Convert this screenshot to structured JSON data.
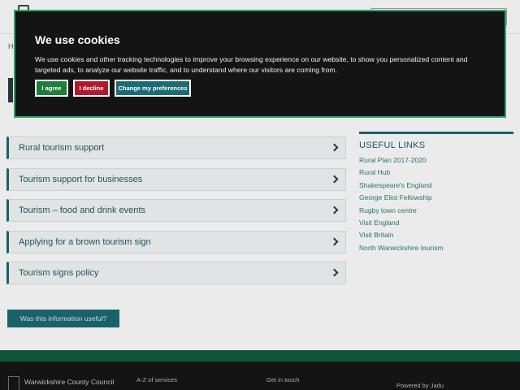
{
  "cookie_banner": {
    "title": "We use cookies",
    "body": "We use cookies and other tracking technologies to improve your browsing experience on our website, to show you personalized content and targeted ads, to analyze our website traffic, and to understand where our visitors are coming from.",
    "agree_label": "I agree",
    "decline_label": "I decline",
    "preferences_label": "Change my preferences"
  },
  "main": {
    "breadcrumb_stub": "H",
    "items": [
      {
        "label": "Rural tourism support"
      },
      {
        "label": "Tourism support for businesses"
      },
      {
        "label": "Tourism – food and drink events"
      },
      {
        "label": "Applying for a brown tourism sign"
      },
      {
        "label": "Tourism signs policy"
      }
    ],
    "feedback_label": "Was this information useful?"
  },
  "useful_links": {
    "heading": "USEFUL LINKS",
    "links": [
      "Rural Plan 2017-2020",
      "Rural Hub",
      "Shakespeare's England",
      "George Eliot Fellowship",
      "Rugby town centre",
      "Visit England",
      "Visit Britain",
      "North Warwickshire tourism"
    ]
  },
  "footer": {
    "org_name": "Warwickshire County Council",
    "az_label": "A-Z of services",
    "get_in_touch": "Get in touch",
    "powered_by": "Powered by Jadu"
  },
  "colors": {
    "banner_bg": "#141414",
    "banner_border": "#2ea35f",
    "agree": "#1e7d3a",
    "decline": "#b0182c",
    "preferences": "#1b6b73",
    "accent": "#1d6a73"
  }
}
